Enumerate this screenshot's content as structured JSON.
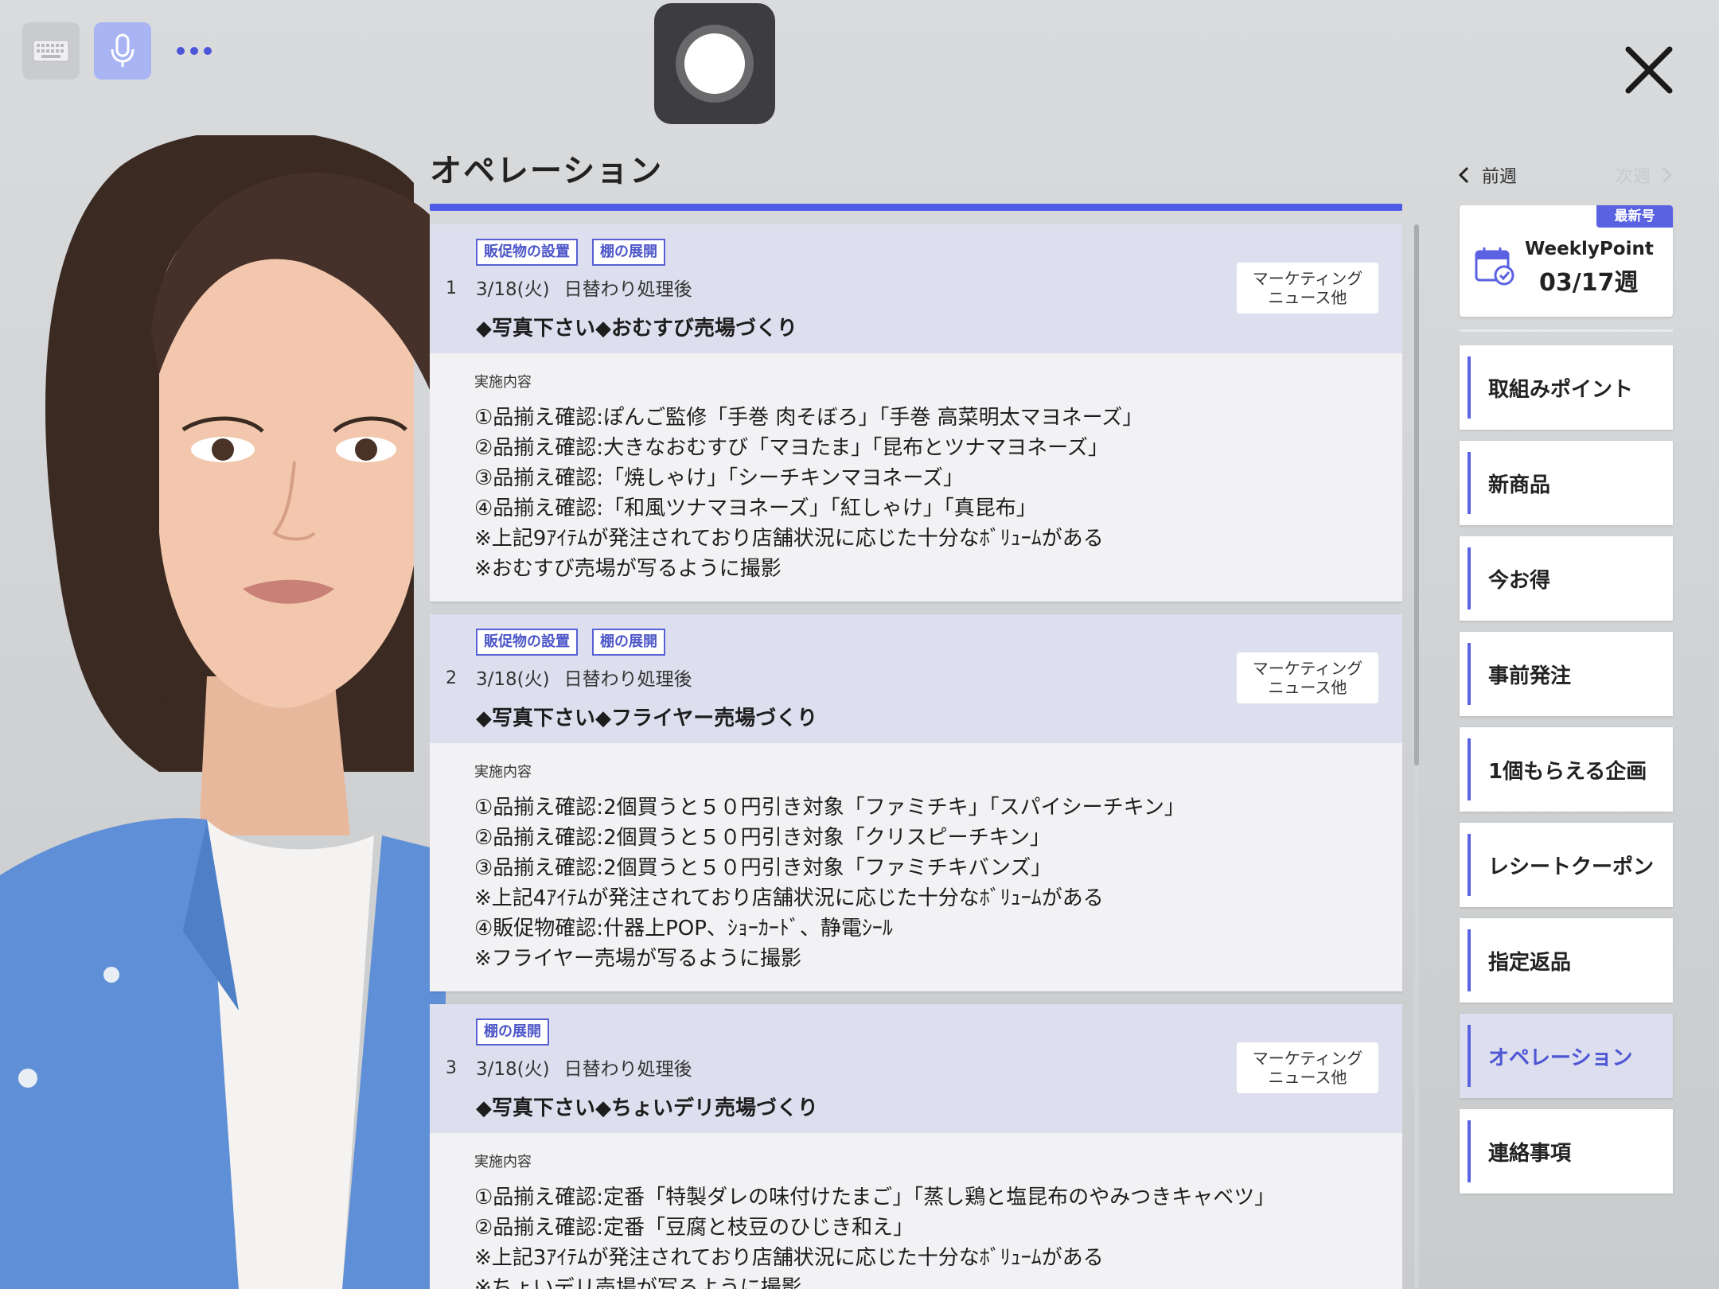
{
  "toolbar": {
    "keyboard_icon": "keyboard-icon",
    "mic_icon": "microphone-icon",
    "more_icon": "more-dots-icon",
    "record_icon": "record-icon",
    "close_icon": "close-icon"
  },
  "page": {
    "title": "オペレーション"
  },
  "colors": {
    "accent": "#4f5ae6",
    "active_bg": "#dddeee",
    "head_bg": "#dedfee"
  },
  "cards": [
    {
      "num": "1",
      "tags": [
        "販促物の設置",
        "棚の展開"
      ],
      "date": "3/18(火)",
      "timing": "日替わり処理後",
      "headline": "◆写真下さい◆おむすび売場づくり",
      "marketing": [
        "マーケティング",
        "ニュース他"
      ],
      "body_label": "実施内容",
      "lines": [
        "①品揃え確認:ぽんご監修「手巻 肉そぼろ」「手巻 高菜明太マヨネーズ」",
        "②品揃え確認:大きなおむすび「マヨたま」「昆布とツナマヨネーズ」",
        "③品揃え確認:「焼しゃけ」「シーチキンマヨネーズ」",
        "④品揃え確認:「和風ツナマヨネーズ」「紅しゃけ」「真昆布」",
        "※上記9ｱｲﾃﾑが発注されており店舗状況に応じた十分なﾎﾞﾘｭｰﾑがある",
        "※おむすび売場が写るように撮影"
      ]
    },
    {
      "num": "2",
      "tags": [
        "販促物の設置",
        "棚の展開"
      ],
      "date": "3/18(火)",
      "timing": "日替わり処理後",
      "headline": "◆写真下さい◆フライヤー売場づくり",
      "marketing": [
        "マーケティング",
        "ニュース他"
      ],
      "body_label": "実施内容",
      "lines": [
        "①品揃え確認:2個買うと５０円引き対象「ファミチキ」「スパイシーチキン」",
        "②品揃え確認:2個買うと５０円引き対象「クリスピーチキン」",
        "③品揃え確認:2個買うと５０円引き対象「ファミチキバンズ」",
        "※上記4ｱｲﾃﾑが発注されており店舗状況に応じた十分なﾎﾞﾘｭｰﾑがある",
        "④販促物確認:什器上POP、ｼｮｰｶｰﾄﾞ、静電ｼｰﾙ",
        "※フライヤー売場が写るように撮影"
      ]
    },
    {
      "num": "3",
      "tags": [
        "棚の展開"
      ],
      "date": "3/18(火)",
      "timing": "日替わり処理後",
      "headline": "◆写真下さい◆ちょいデリ売場づくり",
      "marketing": [
        "マーケティング",
        "ニュース他"
      ],
      "body_label": "実施内容",
      "lines": [
        "①品揃え確認:定番「特製ダレの味付けたまご」「蒸し鶏と塩昆布のやみつきキャベツ」",
        "②品揃え確認:定番「豆腐と枝豆のひじき和え」",
        "※上記3ｱｲﾃﾑが発注されており店舗状況に応じた十分なﾎﾞﾘｭｰﾑがある",
        "※ちょいデリ売場が写るように撮影"
      ]
    }
  ],
  "sidebar": {
    "prev_week": "前週",
    "next_week": "次週",
    "newest_badge": "最新号",
    "weekly_name": "WeeklyPoint",
    "weekly_week": "03/17週",
    "items": [
      {
        "label": "取組みポイント",
        "active": false
      },
      {
        "label": "新商品",
        "active": false
      },
      {
        "label": "今お得",
        "active": false
      },
      {
        "label": "事前発注",
        "active": false
      },
      {
        "label": "1個もらえる企画",
        "active": false
      },
      {
        "label": "レシートクーポン",
        "active": false
      },
      {
        "label": "指定返品",
        "active": false
      },
      {
        "label": "オペレーション",
        "active": true
      },
      {
        "label": "連絡事項",
        "active": false
      }
    ]
  }
}
